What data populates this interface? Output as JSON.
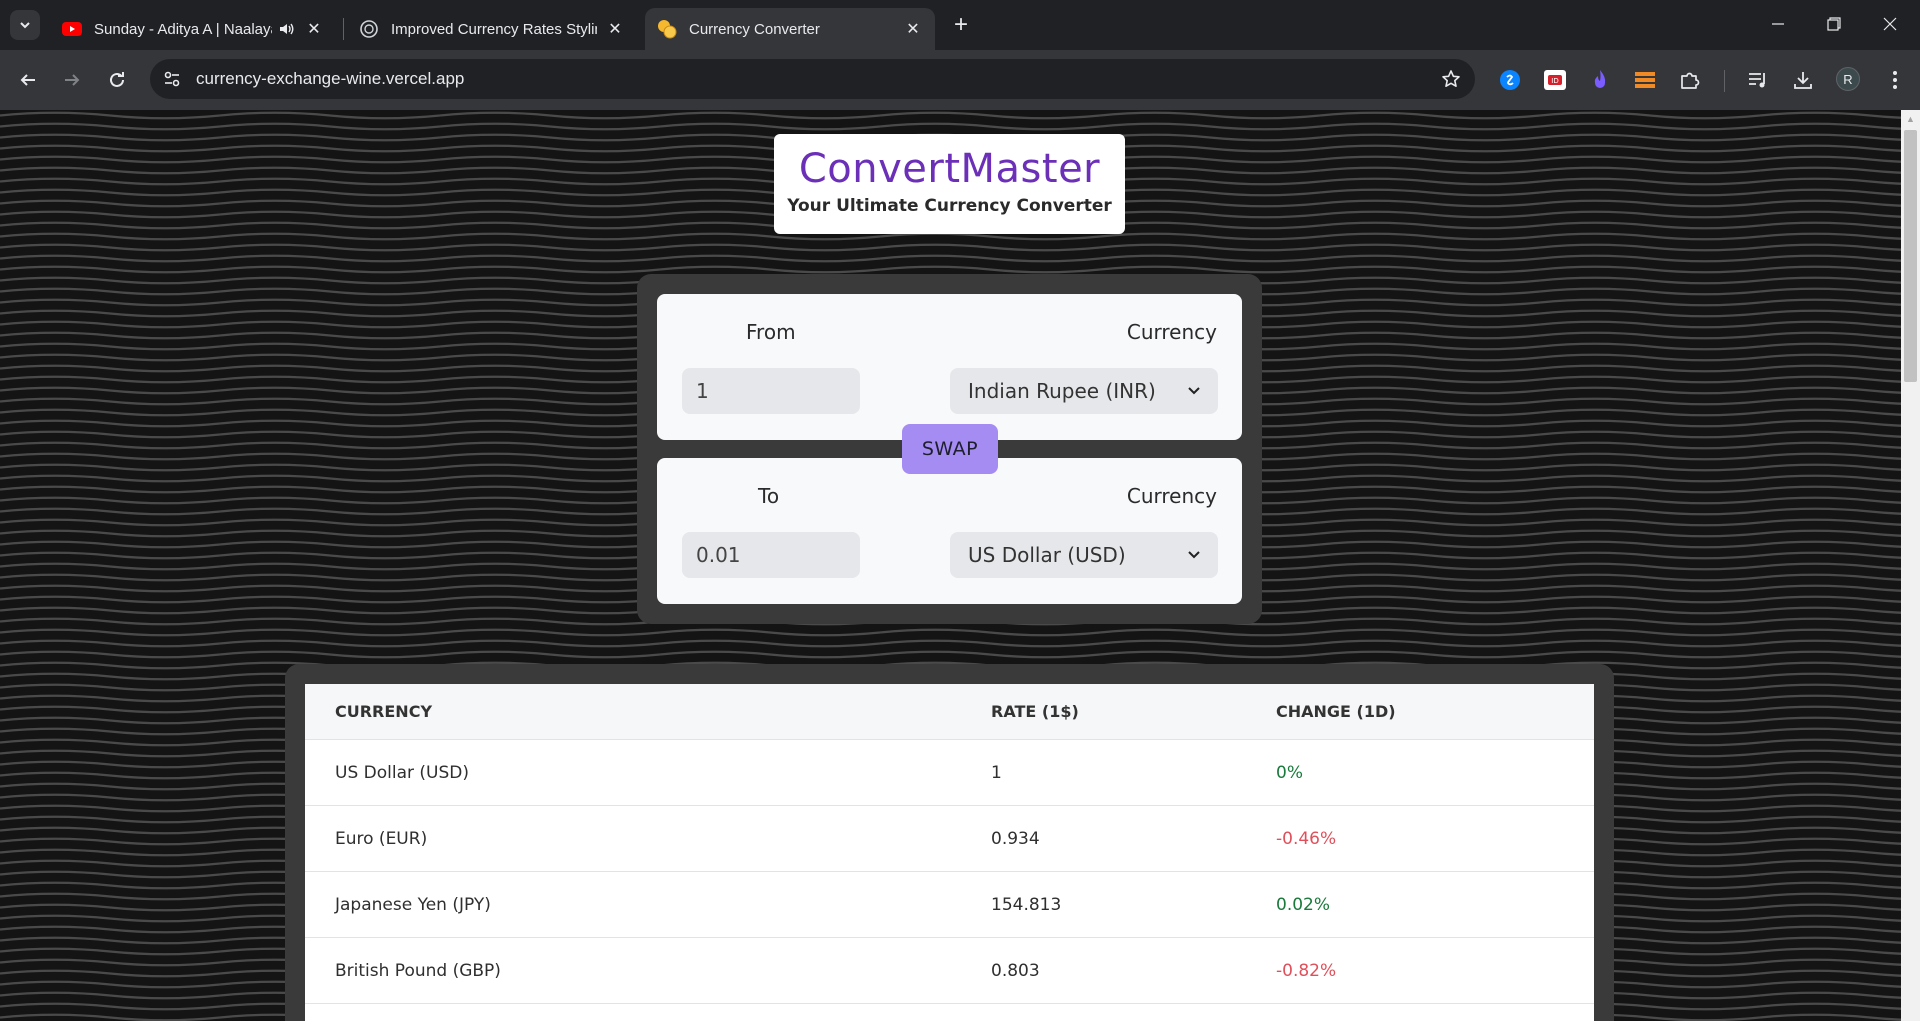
{
  "browser": {
    "tabs": [
      {
        "title": "Sunday - Aditya A | Naalayak",
        "favicon": "youtube-icon",
        "audio": true,
        "active": false
      },
      {
        "title": "Improved Currency Rates Styling",
        "favicon": "chatgpt-icon",
        "audio": false,
        "active": false
      },
      {
        "title": "Currency Converter",
        "favicon": "coins-icon",
        "audio": false,
        "active": true
      }
    ],
    "url": "currency-exchange-wine.vercel.app",
    "profile_initial": "R",
    "extensions": [
      "shazam-icon",
      "redirect-icon",
      "flame-icon",
      "stack-icon",
      "puzzle-icon"
    ]
  },
  "app": {
    "brand_name": "ConvertMaster",
    "tagline": "Your Ultimate Currency Converter",
    "from": {
      "label": "From",
      "currency_label": "Currency",
      "amount": "1",
      "currency": "Indian Rupee (INR)"
    },
    "swap_label": "SWAP",
    "to": {
      "label": "To",
      "currency_label": "Currency",
      "amount": "0.01",
      "currency": "US Dollar (USD)"
    }
  },
  "rates": {
    "headers": [
      "CURRENCY",
      "RATE (1$)",
      "CHANGE (1D)"
    ],
    "rows": [
      {
        "currency": "US Dollar (USD)",
        "rate": "1",
        "change": "0%",
        "direction": "up"
      },
      {
        "currency": "Euro (EUR)",
        "rate": "0.934",
        "change": "-0.46%",
        "direction": "down"
      },
      {
        "currency": "Japanese Yen (JPY)",
        "rate": "154.813",
        "change": "0.02%",
        "direction": "up"
      },
      {
        "currency": "British Pound (GBP)",
        "rate": "0.803",
        "change": "-0.82%",
        "direction": "down"
      }
    ]
  },
  "colors": {
    "brand": "#6b2fb8",
    "swap": "#a48cf2",
    "positive": "#1a7a3c",
    "negative": "#e0505a"
  }
}
